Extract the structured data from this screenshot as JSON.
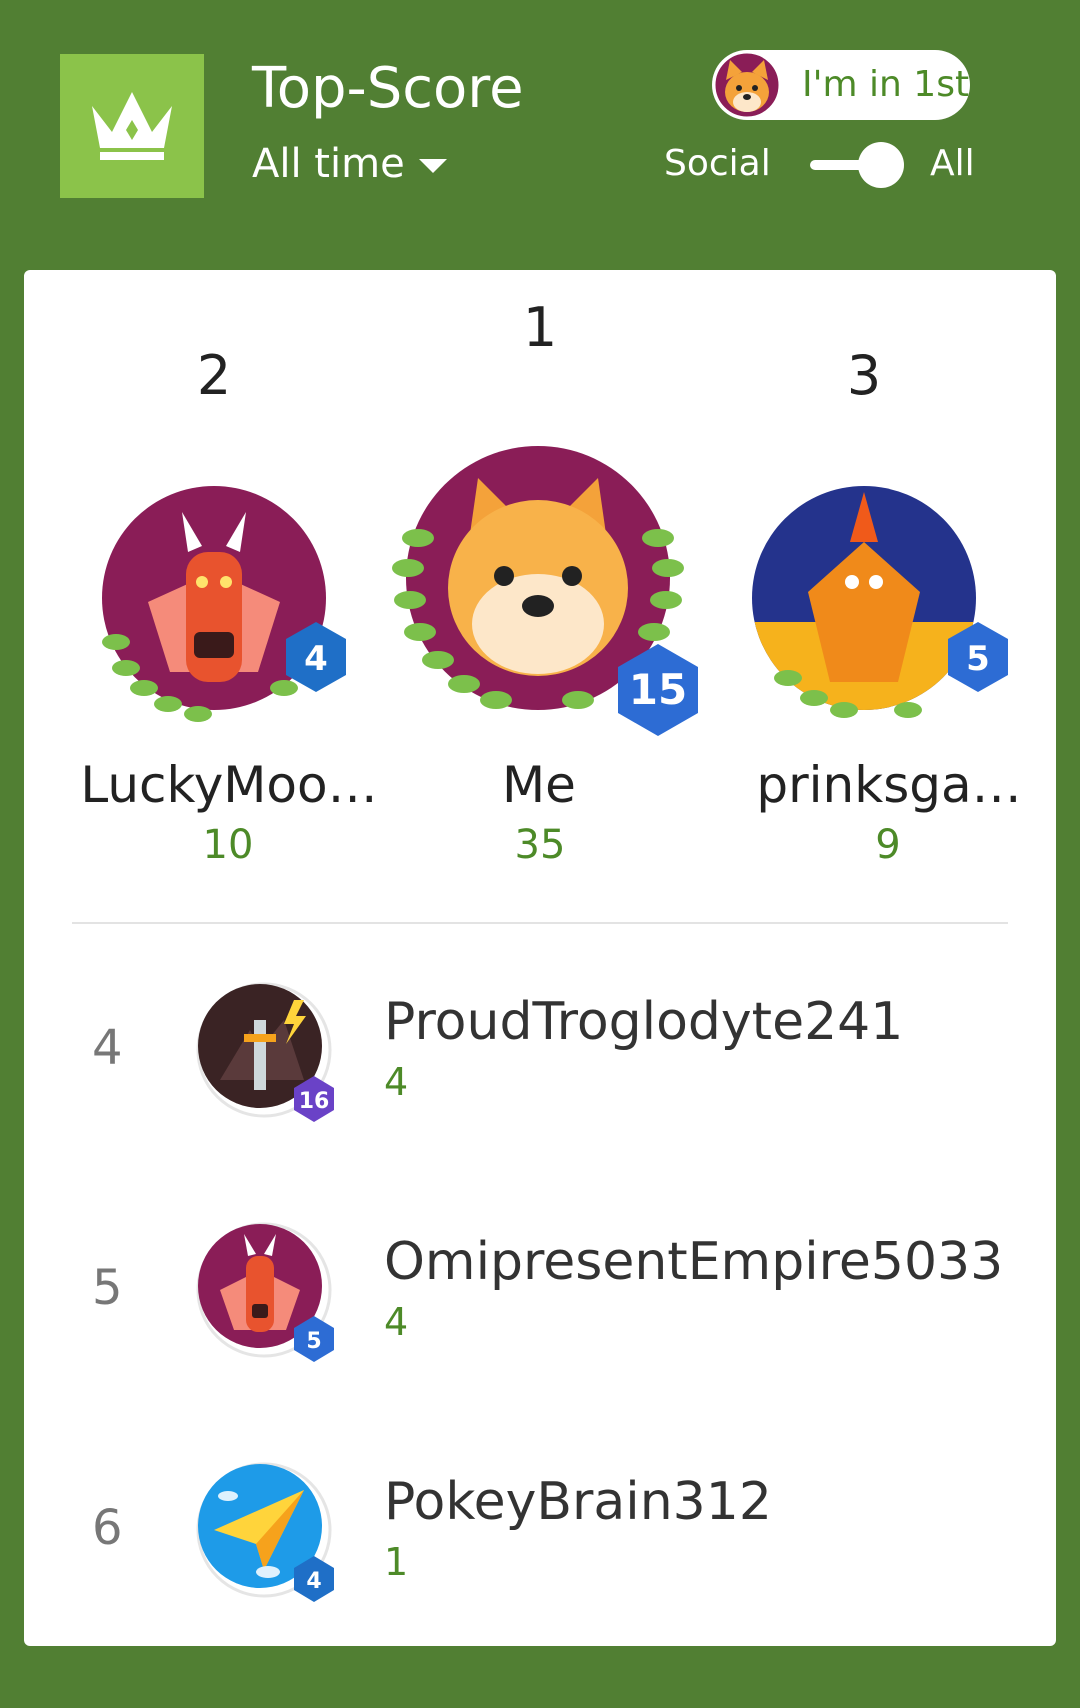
{
  "header": {
    "title": "Top-Score",
    "period": "All time",
    "rank_pill": "I'm in 1st",
    "toggle_left": "Social",
    "toggle_right": "All",
    "crown_icon": "crown-icon"
  },
  "colors": {
    "background": "#517f33",
    "accent": "#8bc34a",
    "score": "#4d8a28",
    "badge": "#1f6fc7"
  },
  "podium": [
    {
      "place": "2",
      "name": "LuckyMoo…",
      "score": "10",
      "level": "4",
      "avatar": "dragon-avatar"
    },
    {
      "place": "1",
      "name": "Me",
      "score": "35",
      "level": "15",
      "avatar": "shiba-avatar"
    },
    {
      "place": "3",
      "name": "prinksga…",
      "score": "9",
      "level": "5",
      "avatar": "phoenix-avatar"
    }
  ],
  "list": [
    {
      "rank": "4",
      "name": "ProudTroglodyte241",
      "score": "4",
      "level": "16",
      "avatar": "sword-avatar"
    },
    {
      "rank": "5",
      "name": "OmipresentEmpire5033",
      "score": "4",
      "level": "5",
      "avatar": "dragon-avatar"
    },
    {
      "rank": "6",
      "name": "PokeyBrain312",
      "score": "1",
      "level": "4",
      "avatar": "paper-plane-avatar"
    }
  ]
}
